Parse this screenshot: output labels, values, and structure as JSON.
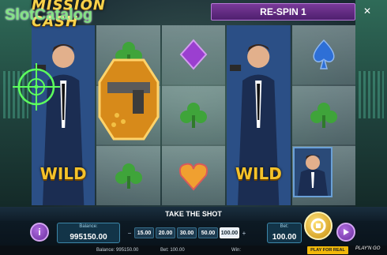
{
  "watermark": "SlotCatalog",
  "logo_text": "MISSION CASH",
  "respin_label": "RE-SPIN 1",
  "close_label": "✕",
  "wild_label": "WILD",
  "take_the_shot": "TAKE THE SHOT",
  "info_label": "i",
  "balance": {
    "label": "Balance:",
    "value": "995150.00"
  },
  "bet": {
    "label": "Bet:",
    "value": "100.00"
  },
  "bet_arrow_left": "−",
  "bet_arrow_right": "+",
  "bet_options": [
    "15.00",
    "20.00",
    "30.00",
    "50.00",
    "100.00"
  ],
  "bet_selected_index": 4,
  "status": {
    "balance": "Balance: 995150.00",
    "bet": "Bet: 100.00",
    "win": "Win:"
  },
  "play_for_real": "PLAY FOR REAL",
  "provider": "PLAY'N GO",
  "colors": {
    "diamond": "#9b3fd0",
    "spade": "#2e6fd6",
    "club": "#3fa43a",
    "heart": "#f0a030",
    "wild": "#f4c22a"
  }
}
